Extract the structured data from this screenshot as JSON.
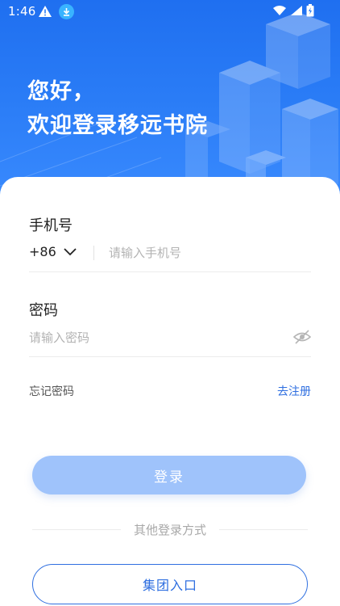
{
  "status_bar": {
    "time": "1:46"
  },
  "hero": {
    "greeting_line1": "您好，",
    "greeting_line2": "欢迎登录移远书院"
  },
  "phone": {
    "label": "手机号",
    "country_code": "+86",
    "placeholder": "请输入手机号",
    "value": ""
  },
  "password": {
    "label": "密码",
    "placeholder": "请输入密码",
    "value": ""
  },
  "links": {
    "forgot": "忘记密码",
    "register": "去注册"
  },
  "login_button": "登录",
  "other_methods": "其他登录方式",
  "group_button": "集团入口",
  "colors": {
    "hero_blue": "#2a7cf6",
    "accent": "#2f6fe0",
    "login_disabled": "#9fc3fb"
  }
}
